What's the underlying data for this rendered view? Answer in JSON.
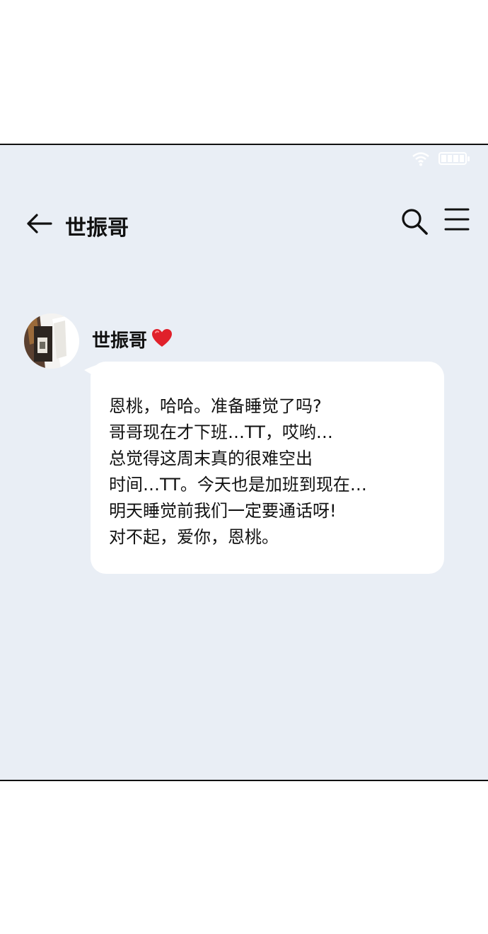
{
  "header": {
    "title": "世振哥",
    "back_icon": "arrow-left-icon",
    "search_icon": "search-icon",
    "menu_icon": "menu-icon"
  },
  "status_bar": {
    "wifi_icon": "wifi-icon",
    "battery_icon": "battery-icon"
  },
  "message": {
    "sender": "世振哥",
    "heart": "❤️",
    "lines": [
      "恩桃，哈哈。准备睡觉了吗?",
      "哥哥现在才下班…TT，哎哟…",
      "总觉得这周末真的很难空出",
      "时间…TT。今天也是加班到现在…",
      "明天睡觉前我们一定要通话呀!",
      "对不起，爱你，恩桃。"
    ]
  },
  "colors": {
    "panel_bg": "#e9eef5",
    "bubble_bg": "#ffffff",
    "text": "#111111"
  }
}
